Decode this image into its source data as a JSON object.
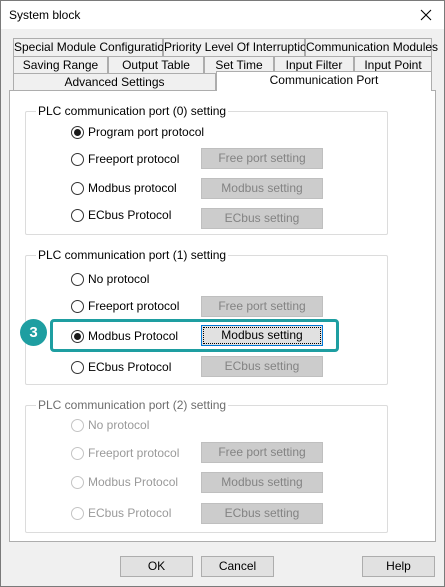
{
  "window": {
    "title": "System block",
    "close_icon": "close-icon"
  },
  "tabs": {
    "row1": [
      "Special Module Configuration",
      "Priority Level Of Interruption",
      "Communication Modules"
    ],
    "row2": [
      "Saving Range",
      "Output Table",
      "Set Time",
      "Input Filter",
      "Input Point"
    ],
    "row3": [
      "Advanced Settings",
      "Communication Port"
    ],
    "active": "Communication Port"
  },
  "port0": {
    "title": "PLC communication port (0) setting",
    "options": [
      "Program port protocol",
      "Freeport protocol",
      "Modbus protocol",
      "ECbus Protocol"
    ],
    "selected": "Program port protocol",
    "buttons": [
      "Free port setting",
      "Modbus setting",
      "ECbus setting"
    ]
  },
  "port1": {
    "title": "PLC communication port (1) setting",
    "options": [
      "No protocol",
      "Freeport protocol",
      "Modbus Protocol",
      "ECbus Protocol"
    ],
    "selected": "Modbus Protocol",
    "buttons": [
      "Free port setting",
      "Modbus setting",
      "ECbus setting"
    ]
  },
  "port2": {
    "title": "PLC communication port (2) setting",
    "options": [
      "No protocol",
      "Freeport protocol",
      "Modbus Protocol",
      "ECbus Protocol"
    ],
    "buttons": [
      "Free port setting",
      "Modbus setting",
      "ECbus setting"
    ]
  },
  "annotation": {
    "step": "3",
    "color": "#1e9ea1"
  },
  "footer": {
    "ok": "OK",
    "cancel": "Cancel",
    "help": "Help"
  }
}
